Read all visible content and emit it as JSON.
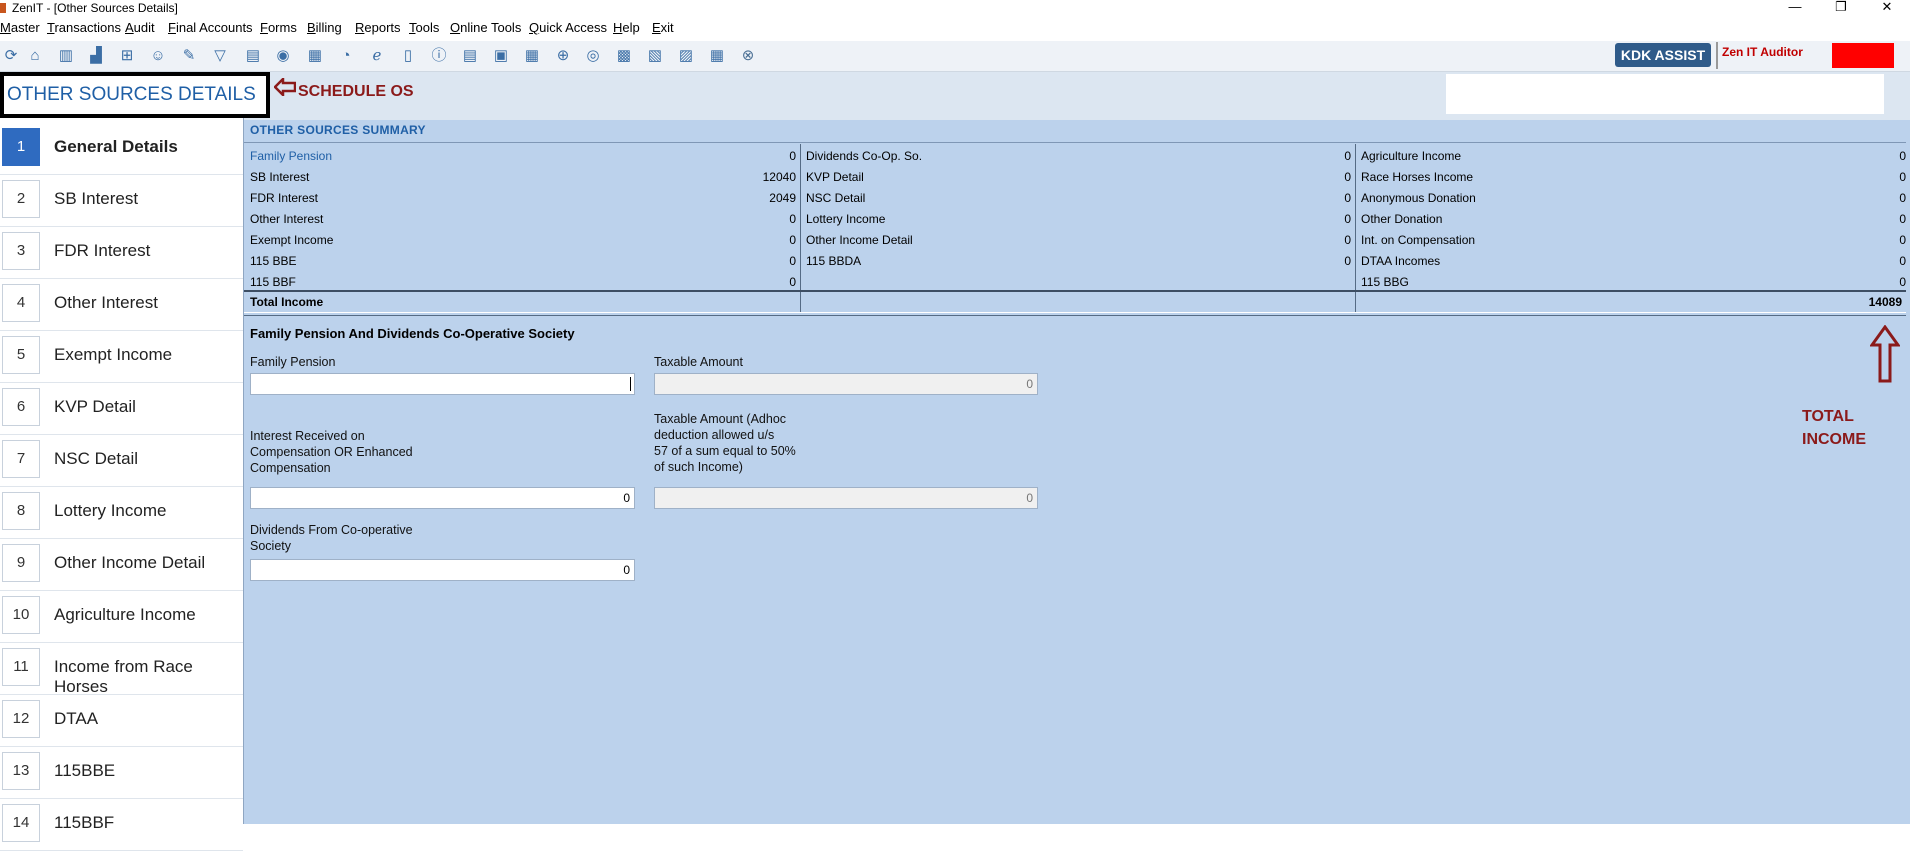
{
  "window": {
    "title": "ZenIT - [Other Sources Details]",
    "min": "—",
    "max": "❐",
    "close": "✕"
  },
  "menu": [
    "Master",
    "Transactions",
    "Audit",
    "Final Accounts",
    "Forms",
    "Billing",
    "Reports",
    "Tools",
    "Online Tools",
    "Quick Access",
    "Help",
    "Exit"
  ],
  "toolbar": {
    "icons": [
      "refresh-icon",
      "home-icon",
      "building-icon",
      "bar-chart-icon",
      "gift-icon",
      "people-icon",
      "pin-icon",
      "filter-icon",
      "tax-icon",
      "arrows-icon",
      "calculator-icon",
      "pie-icon",
      "epay-icon",
      "book-icon",
      "info-search-icon",
      "report-icon",
      "user-report-icon",
      "calendar-icon",
      "folder-add-icon",
      "globe-icon",
      "bis-icon",
      "bsh-icon",
      "3cd-icon",
      "layout-icon",
      "close-circle-icon"
    ],
    "kdk_label": "KDK ASSIST",
    "auditor_label": "Zen IT Auditor"
  },
  "sidebar": {
    "heading": "OTHER SOURCES DETAILS",
    "items": [
      {
        "num": "1",
        "label": "General Details",
        "active": true
      },
      {
        "num": "2",
        "label": "SB Interest"
      },
      {
        "num": "3",
        "label": "FDR Interest"
      },
      {
        "num": "4",
        "label": "Other Interest"
      },
      {
        "num": "5",
        "label": "Exempt Income"
      },
      {
        "num": "6",
        "label": "KVP Detail"
      },
      {
        "num": "7",
        "label": "NSC Detail"
      },
      {
        "num": "8",
        "label": "Lottery Income"
      },
      {
        "num": "9",
        "label": "Other Income Detail"
      },
      {
        "num": "10",
        "label": "Agriculture Income"
      },
      {
        "num": "11",
        "label": "Income from Race Horses"
      },
      {
        "num": "12",
        "label": "DTAA"
      },
      {
        "num": "13",
        "label": "115BBE"
      },
      {
        "num": "14",
        "label": "115BBF"
      }
    ]
  },
  "annotations": {
    "schedule": "SCHEDULE OS",
    "total_line1": "TOTAL",
    "total_line2": "INCOME"
  },
  "summary": {
    "title": "OTHER SOURCES SUMMARY",
    "col1": [
      {
        "k": "Family Pension",
        "v": "0"
      },
      {
        "k": "SB Interest",
        "v": "12040"
      },
      {
        "k": "FDR Interest",
        "v": "2049"
      },
      {
        "k": "Other Interest",
        "v": "0"
      },
      {
        "k": "Exempt Income",
        "v": "0"
      },
      {
        "k": "115 BBE",
        "v": "0"
      },
      {
        "k": "115 BBF",
        "v": "0"
      }
    ],
    "col2": [
      {
        "k": "Dividends Co-Op. So.",
        "v": "0"
      },
      {
        "k": "KVP Detail",
        "v": "0"
      },
      {
        "k": "NSC Detail",
        "v": "0"
      },
      {
        "k": "Lottery Income",
        "v": "0"
      },
      {
        "k": "Other Income Detail",
        "v": "0"
      },
      {
        "k": "115 BBDA",
        "v": "0"
      }
    ],
    "col3": [
      {
        "k": "Agriculture Income",
        "v": "0"
      },
      {
        "k": "Race Horses Income",
        "v": "0"
      },
      {
        "k": "Anonymous Donation",
        "v": "0"
      },
      {
        "k": "Other Donation",
        "v": "0"
      },
      {
        "k": "Int. on Compensation",
        "v": "0"
      },
      {
        "k": "DTAA Incomes",
        "v": "0"
      },
      {
        "k": "115 BBG",
        "v": "0"
      }
    ],
    "total_label": "Total Income",
    "total_value": "14089"
  },
  "form": {
    "section_title": "Family Pension And Dividends Co-Operative Society",
    "family_pension_label": "Family Pension",
    "family_pension_value": "",
    "taxable_label": "Taxable Amount",
    "taxable_value": "0",
    "interest_label_1": "Interest Received on",
    "interest_label_2": "Compensation OR Enhanced",
    "interest_label_3": "Compensation",
    "interest_value": "0",
    "adhoc_label_1": "Taxable Amount (Adhoc",
    "adhoc_label_2": "deduction allowed u/s",
    "adhoc_label_3": "57 of a sum equal to 50%",
    "adhoc_label_4": "of such Income)",
    "adhoc_value": "0",
    "dividends_label_1": "Dividends From Co-operative",
    "dividends_label_2": "Society",
    "dividends_value": "0"
  }
}
